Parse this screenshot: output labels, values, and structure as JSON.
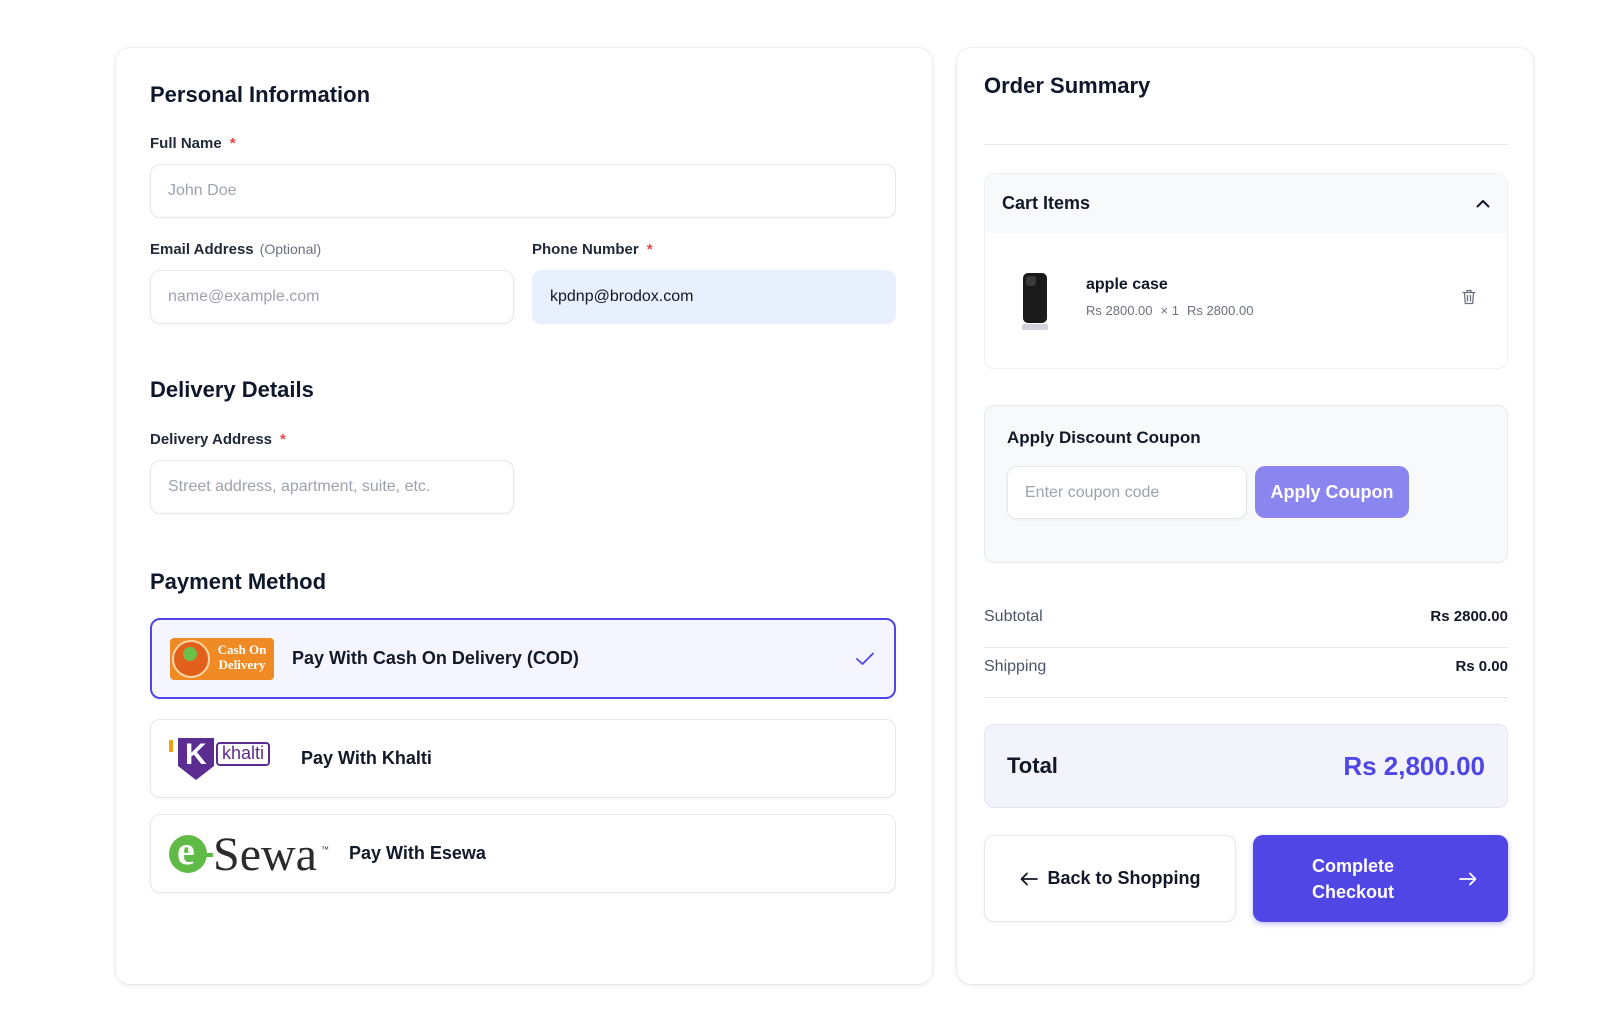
{
  "personal": {
    "title": "Personal Information",
    "full_name_label": "Full Name",
    "full_name_placeholder": "John Doe",
    "email_label": "Email Address",
    "email_optional": "(Optional)",
    "email_placeholder": "name@example.com",
    "phone_label": "Phone Number",
    "phone_value": "kpdnp@brodox.com",
    "required_mark": "*"
  },
  "delivery": {
    "title": "Delivery Details",
    "address_label": "Delivery Address",
    "address_placeholder": "Street address, apartment, suite, etc."
  },
  "payment": {
    "title": "Payment Method",
    "options": [
      {
        "label": "Pay With Cash On Delivery (COD)",
        "logo_line1": "Cash On",
        "logo_line2": "Delivery",
        "selected": true
      },
      {
        "label": "Pay With Khalti",
        "logo_k": "K",
        "logo_text": "khalti",
        "selected": false
      },
      {
        "label": "Pay With Esewa",
        "logo_e": "e",
        "logo_text": "Sewa",
        "logo_tm": "™",
        "selected": false
      }
    ]
  },
  "summary": {
    "title": "Order Summary",
    "cart_title": "Cart Items",
    "item": {
      "name": "apple case",
      "unit_price": "Rs 2800.00",
      "qty": "× 1",
      "line_total": "Rs 2800.00"
    },
    "coupon_title": "Apply Discount Coupon",
    "coupon_placeholder": "Enter coupon code",
    "coupon_button": "Apply Coupon",
    "subtotal_label": "Subtotal",
    "subtotal_value": "Rs 2800.00",
    "shipping_label": "Shipping",
    "shipping_value": "Rs 0.00",
    "total_label": "Total",
    "total_value": "Rs 2,800.00",
    "back_button": "Back to Shopping",
    "checkout_line1": "Complete",
    "checkout_line2": "Checkout"
  },
  "colors": {
    "accent": "#4f46e5",
    "accent_light": "#8b85ef",
    "required": "#ef4444",
    "selected_bg": "#f5f5ff"
  }
}
